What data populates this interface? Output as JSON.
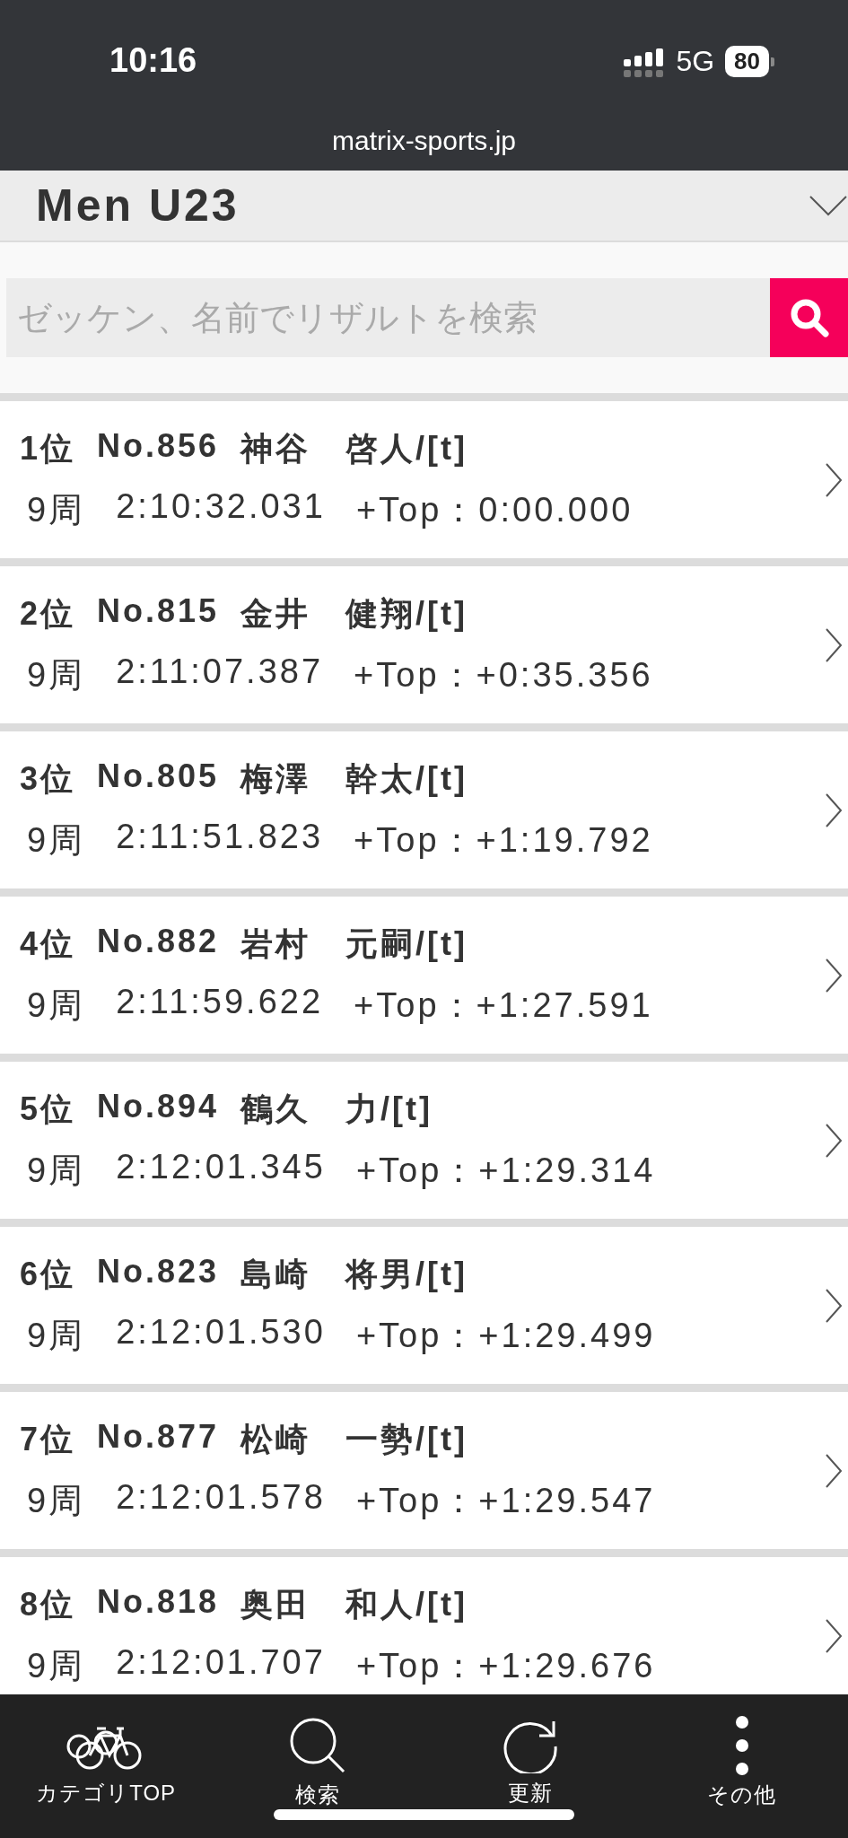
{
  "status_bar": {
    "time": "10:16",
    "network": "5G",
    "battery": "80"
  },
  "url": "matrix-sports.jp",
  "category": {
    "title": "Men U23"
  },
  "search": {
    "placeholder": "ゼッケン、名前でリザルトを検索"
  },
  "results": [
    {
      "rank": "1位",
      "number": "No.856",
      "name": "神谷　啓人/[t]",
      "laps": "9周",
      "time": "2:10:32.031",
      "gap": "+Top：0:00.000"
    },
    {
      "rank": "2位",
      "number": "No.815",
      "name": "金井　健翔/[t]",
      "laps": "9周",
      "time": "2:11:07.387",
      "gap": "+Top：+0:35.356"
    },
    {
      "rank": "3位",
      "number": "No.805",
      "name": "梅澤　幹太/[t]",
      "laps": "9周",
      "time": "2:11:51.823",
      "gap": "+Top：+1:19.792"
    },
    {
      "rank": "4位",
      "number": "No.882",
      "name": "岩村　元嗣/[t]",
      "laps": "9周",
      "time": "2:11:59.622",
      "gap": "+Top：+1:27.591"
    },
    {
      "rank": "5位",
      "number": "No.894",
      "name": "鶴久　力/[t]",
      "laps": "9周",
      "time": "2:12:01.345",
      "gap": "+Top：+1:29.314"
    },
    {
      "rank": "6位",
      "number": "No.823",
      "name": "島崎　将男/[t]",
      "laps": "9周",
      "time": "2:12:01.530",
      "gap": "+Top：+1:29.499"
    },
    {
      "rank": "7位",
      "number": "No.877",
      "name": "松崎　一勢/[t]",
      "laps": "9周",
      "time": "2:12:01.578",
      "gap": "+Top：+1:29.547"
    },
    {
      "rank": "8位",
      "number": "No.818",
      "name": "奥田　和人/[t]",
      "laps": "9周",
      "time": "2:12:01.707",
      "gap": "+Top：+1:29.676"
    }
  ],
  "nav": [
    {
      "kind": "bikes",
      "label": "カテゴリTOP"
    },
    {
      "kind": "search",
      "label": "検索"
    },
    {
      "kind": "refresh",
      "label": "更新"
    },
    {
      "kind": "more",
      "label": "その他"
    }
  ]
}
